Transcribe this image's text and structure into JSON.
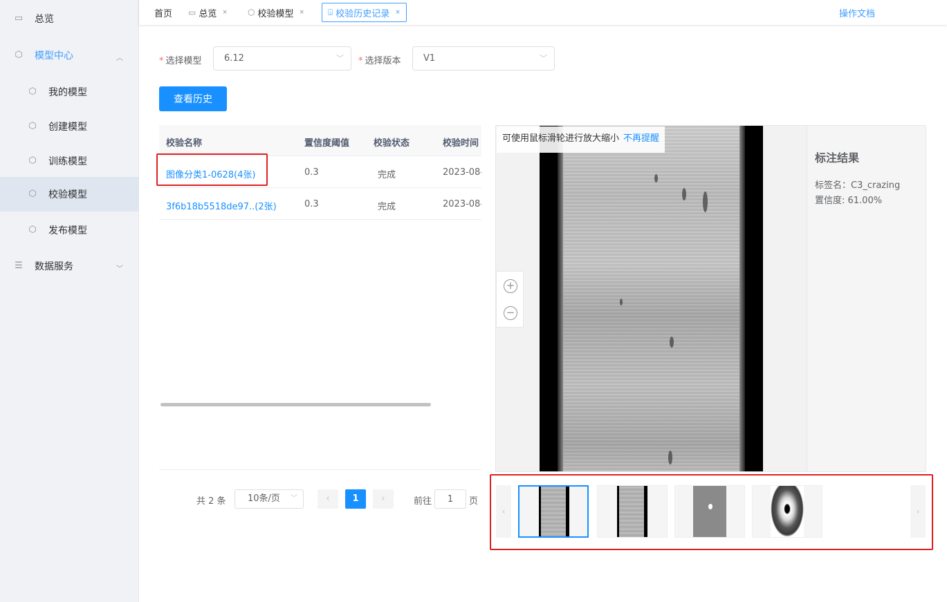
{
  "sidebar": {
    "items": [
      {
        "label": "总览"
      },
      {
        "label": "模型中心"
      },
      {
        "label": "我的模型"
      },
      {
        "label": "创建模型"
      },
      {
        "label": "训练模型"
      },
      {
        "label": "校验模型"
      },
      {
        "label": "发布模型"
      },
      {
        "label": "数据服务"
      }
    ]
  },
  "tabs": {
    "home": "首页",
    "overview": "总览",
    "verify_model": "校验模型",
    "history": "校验历史记录",
    "close": "×",
    "doc_link": "操作文档"
  },
  "form": {
    "req": "*",
    "model_label": "选择模型",
    "model_value": "6.12",
    "version_label": "选择版本",
    "version_value": "V1",
    "query_button": "查看历史"
  },
  "table": {
    "headers": [
      "校验名称",
      "置信度阈值",
      "校验状态",
      "校验时间"
    ],
    "rows": [
      {
        "name": "图像分类1-0628(4张)",
        "threshold": "0.3",
        "status": "完成",
        "time": "2023-08-"
      },
      {
        "name": "3f6b18b5518de97..(2张)",
        "threshold": "0.3",
        "status": "完成",
        "time": "2023-08-"
      }
    ]
  },
  "pagination": {
    "total": "共 2 条",
    "page_size": "10条/页",
    "prev": "‹",
    "current": "1",
    "next": "›",
    "goto_prefix": "前往",
    "goto_value": "1",
    "goto_suffix": "页"
  },
  "viewer": {
    "hint": "可使用鼠标滑轮进行放大缩小",
    "hint_link": "不再提醒",
    "zoom_in": "+",
    "zoom_out": "−",
    "result_title": "标注结果",
    "label_line": "标签名：C3_crazing",
    "confidence_line": "置信度: 61.00%"
  },
  "thumbnails": {
    "prev": "‹",
    "next": "›"
  },
  "colors": {
    "primary": "#1890ff",
    "highlight": "#e02020",
    "sidebar_bg": "#f0f2f5"
  }
}
